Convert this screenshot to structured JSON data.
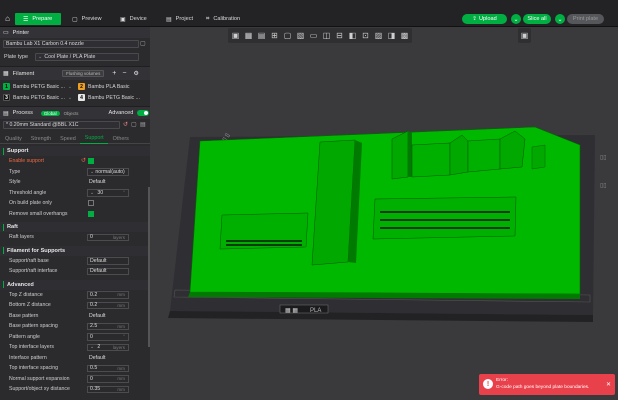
{
  "topbar": {
    "tabs": [
      {
        "label": "Prepare",
        "icon": "prepare-icon",
        "active": true
      },
      {
        "label": "Preview",
        "icon": "preview-icon",
        "active": false
      },
      {
        "label": "Device",
        "icon": "device-icon",
        "active": false
      },
      {
        "label": "Project",
        "icon": "project-icon",
        "active": false
      },
      {
        "label": "Calibration",
        "icon": "calibration-icon",
        "active": false
      }
    ],
    "upload_label": "Upload",
    "slice_label": "Slice all",
    "print_label": "Print plate"
  },
  "printer": {
    "section_title": "Printer",
    "name": "Bambu Lab X1 Carbon 0.4 nozzle",
    "plate_type_label": "Plate type",
    "plate_type_value": "Cool Plate / PLA Plate"
  },
  "filament": {
    "section_title": "Filament",
    "flushing_label": "Flushing volumes",
    "items": [
      {
        "num": "1",
        "label": "Bambu PETG Basic ...",
        "color": "#00ae42"
      },
      {
        "num": "2",
        "label": "Bambu PLA Basic",
        "color": "#f0a020"
      },
      {
        "num": "3",
        "label": "Bambu PETG Basic ...",
        "color": "#111111"
      },
      {
        "num": "4",
        "label": "Bambu PETG Basic ...",
        "color": "#e8e8e8"
      }
    ]
  },
  "process": {
    "section_title": "Process",
    "global_label": "Global",
    "objects_label": "Objects",
    "advanced_label": "Advanced",
    "preset": "* 0.20mm Standard @BBL X1C",
    "tabs": [
      "Quality",
      "Strength",
      "Speed",
      "Support",
      "Others"
    ],
    "active_tab": "Support"
  },
  "support": {
    "group_title": "Support",
    "enable_label": "Enable support",
    "type_label": "Type",
    "type_value": "normal(auto)",
    "style_label": "Style",
    "style_value": "Default",
    "threshold_label": "Threshold angle",
    "threshold_value": "30",
    "threshold_unit": "°",
    "buildplate_label": "On build plate only",
    "remove_small_label": "Remove small overhangs"
  },
  "raft": {
    "group_title": "Raft",
    "layers_label": "Raft layers",
    "layers_value": "0",
    "layers_unit": "layers"
  },
  "filament_support": {
    "group_title": "Filament for Supports",
    "base_label": "Support/raft base",
    "base_value": "Default",
    "interface_label": "Support/raft interface",
    "interface_value": "Default"
  },
  "advanced": {
    "group_title": "Advanced",
    "rows": [
      {
        "label": "Top Z distance",
        "value": "0.2",
        "unit": "mm"
      },
      {
        "label": "Bottom Z distance",
        "value": "0.2",
        "unit": "mm"
      },
      {
        "label": "Base pattern",
        "value": "Default",
        "unit": ""
      },
      {
        "label": "Base pattern spacing",
        "value": "2.5",
        "unit": "mm"
      },
      {
        "label": "Pattern angle",
        "value": "0",
        "unit": "°"
      },
      {
        "label": "Top interface layers",
        "value": "2",
        "unit": "layers"
      },
      {
        "label": "Interface pattern",
        "value": "Default",
        "unit": ""
      },
      {
        "label": "Top interface spacing",
        "value": "0.5",
        "unit": "mm"
      },
      {
        "label": "Normal support expansion",
        "value": "0",
        "unit": "mm"
      },
      {
        "label": "Support/object xy distance",
        "value": "0.35",
        "unit": "mm"
      }
    ]
  },
  "plate": {
    "label": "PLA",
    "bed_color": "#3b3b3f",
    "model_color": "#00b800"
  },
  "error": {
    "title": "Error:",
    "message": "G-code path goes beyond plate boundaries.",
    "color": "#e8414b"
  }
}
